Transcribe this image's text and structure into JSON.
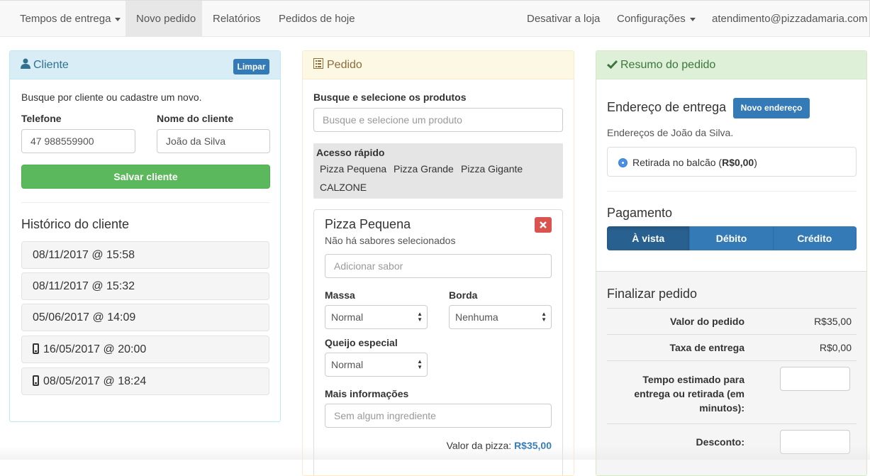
{
  "nav": {
    "tempos": "Tempos de entrega",
    "novo": "Novo pedido",
    "relatorios": "Relatórios",
    "hoje": "Pedidos de hoje",
    "desativar": "Desativar a loja",
    "config": "Configurações",
    "email": "atendimento@pizzadamaria.com"
  },
  "cliente": {
    "title": "Cliente",
    "limpar": "Limpar",
    "intro": "Busque por cliente ou cadastre um novo.",
    "tel_label": "Telefone",
    "tel_value": "47 988559900",
    "nome_label": "Nome do cliente",
    "nome_value": "João da Silva",
    "salvar": "Salvar cliente",
    "hist_title": "Histórico do cliente",
    "history": [
      {
        "text": "08/11/2017 @ 15:58",
        "icon": ""
      },
      {
        "text": "08/11/2017 @ 15:32",
        "icon": ""
      },
      {
        "text": "05/06/2017 @ 14:09",
        "icon": ""
      },
      {
        "text": "16/05/2017 @ 20:00",
        "icon": "phone-icon"
      },
      {
        "text": "08/05/2017 @ 18:24",
        "icon": "phone-icon"
      }
    ]
  },
  "pedido": {
    "title": "Pedido",
    "busca_label": "Busque e selecione os produtos",
    "busca_ph": "Busque e selecione um produto",
    "acesso": "Acesso rápido",
    "quick": [
      "Pizza Pequena",
      "Pizza Grande",
      "Pizza Gigante",
      "CALZONE"
    ],
    "item_title": "Pizza Pequena",
    "item_sub": "Não há sabores selecionados",
    "sabor_ph": "Adicionar sabor",
    "massa_label": "Massa",
    "massa_value": "Normal",
    "borda_label": "Borda",
    "borda_value": "Nenhuma",
    "queijo_label": "Queijo especial",
    "queijo_value": "Normal",
    "mais_label": "Mais informações",
    "mais_ph": "Sem algum ingrediente",
    "valor_label": "Valor da pizza:",
    "valor_value": "R$35,00"
  },
  "resumo": {
    "title": "Resumo do pedido",
    "endereco_title": "Endereço de entrega",
    "novo_endereco": "Novo endereço",
    "enderecos_de": "Endereços de João da Silva.",
    "retirada_pre": "Retirada no balcão (",
    "retirada_val": "R$0,00",
    "retirada_post": ")",
    "pagamento": "Pagamento",
    "pay": [
      "À vista",
      "Débito",
      "Crédito"
    ],
    "finalizar": "Finalizar pedido",
    "valor_label": "Valor do pedido",
    "valor_value": "R$35,00",
    "taxa_label": "Taxa de entrega",
    "taxa_value": "R$0,00",
    "tempo_label_1": "Tempo estimado para",
    "tempo_label_2": "entrega ou retirada (em",
    "tempo_label_3": "minutos):",
    "desconto_label": "Desconto:"
  },
  "colors": {
    "primary": "#337ab7",
    "success": "#5cb85c",
    "danger": "#d9534f",
    "info_bg": "#d9edf7",
    "warning_bg": "#fcf8e3",
    "success_bg": "#dff0d8"
  }
}
